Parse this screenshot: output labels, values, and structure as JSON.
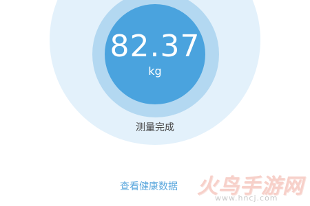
{
  "measurement": {
    "value": "82.37",
    "unit": "kg",
    "status": "测量完成"
  },
  "actions": {
    "view_health_data": "查看健康数据"
  },
  "watermark": {
    "text": "火鸟手游网",
    "url": "www.hncj.com"
  },
  "colors": {
    "ring_outer": "#e3f1fb",
    "ring_middle": "#b3d8f1",
    "ring_inner": "#4aa3de",
    "link": "#5aa7dd",
    "status_text": "#444444"
  }
}
